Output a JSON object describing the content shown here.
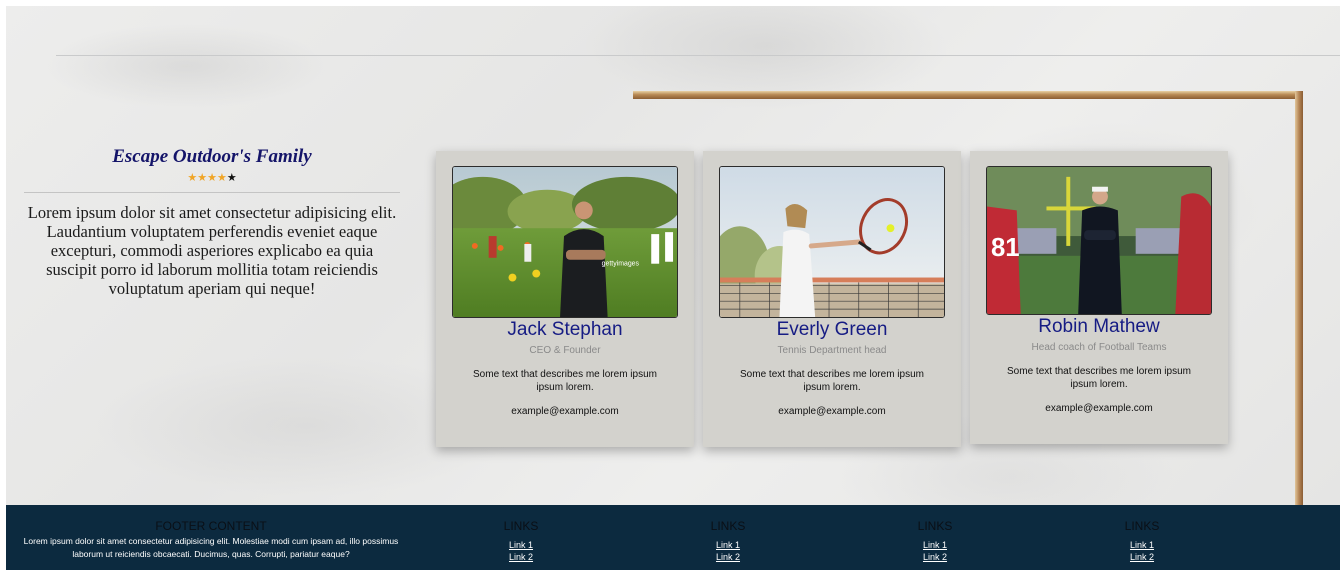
{
  "intro": {
    "title": "Escape Outdoor's Family",
    "rating": 4,
    "rating_max": 5,
    "body": "Lorem ipsum dolor sit amet consectetur adipisicing elit. Laudantium voluptatem perferendis eveniet eaque excepturi, commodi asperiores explicabo ea quia suscipit porro id laborum mollitia totam reiciendis voluptatum aperiam qui neque!"
  },
  "team": [
    {
      "name": "Jack Stephan",
      "role": "CEO & Founder",
      "desc": "Some text that describes me lorem ipsum ipsum lorem.",
      "email": "example@example.com",
      "photo_watermark": "gettyimages"
    },
    {
      "name": "Everly Green",
      "role": "Tennis Department head",
      "desc": "Some text that describes me lorem ipsum ipsum lorem.",
      "email": "example@example.com"
    },
    {
      "name": "Robin Mathew",
      "role": "Head coach of Football Teams",
      "desc": "Some text that describes me lorem ipsum ipsum lorem.",
      "email": "example@example.com",
      "jersey_number": "81"
    }
  ],
  "footer": {
    "content_heading": "FOOTER CONTENT",
    "content_text": "Lorem ipsum dolor sit amet consectetur adipisicing elit. Molestiae modi cum ipsam ad, illo possimus laborum ut reiciendis obcaecati. Ducimus, quas. Corrupti, pariatur eaque?",
    "link_columns": [
      {
        "heading": "LINKS",
        "links": [
          "Link 1",
          "Link 2"
        ]
      },
      {
        "heading": "LINKS",
        "links": [
          "Link 1",
          "Link 2"
        ]
      },
      {
        "heading": "LINKS",
        "links": [
          "Link 1",
          "Link 2"
        ]
      },
      {
        "heading": "LINKS",
        "links": [
          "Link 1",
          "Link 2"
        ]
      }
    ]
  },
  "colors": {
    "accent_gold": "#b88a55",
    "footer_bg": "#0c2a3f",
    "name_blue": "#161c84",
    "star": "#f0a527"
  }
}
